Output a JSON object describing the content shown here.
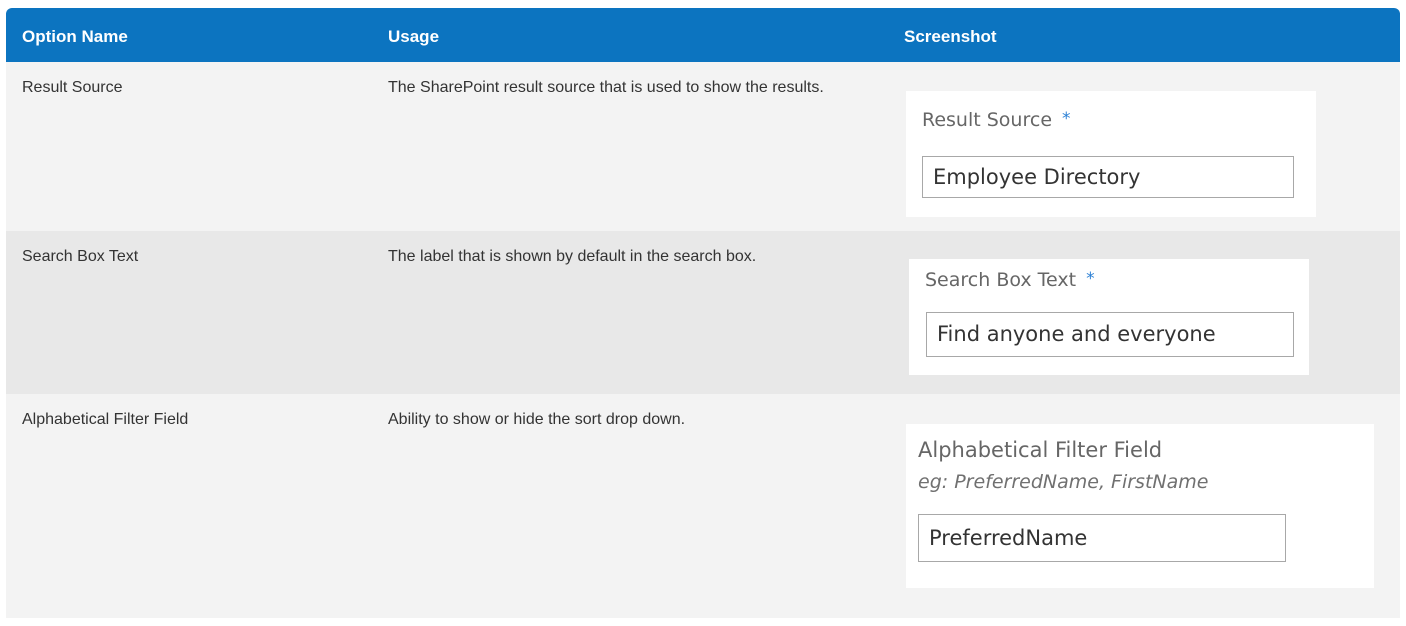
{
  "header": {
    "option_name": "Option Name",
    "usage": "Usage",
    "screenshot": "Screenshot"
  },
  "rows": [
    {
      "option_name": "Result Source",
      "usage": "The SharePoint result source that is used to show the results.",
      "screenshot": {
        "label": "Result Source",
        "required_mark": "*",
        "value": "Employee Directory"
      }
    },
    {
      "option_name": "Search Box Text",
      "usage": "The label that is shown by default in the search box.",
      "screenshot": {
        "label": "Search Box Text",
        "required_mark": "*",
        "value": "Find anyone and everyone"
      }
    },
    {
      "option_name": "Alphabetical Filter Field",
      "usage": "Ability to show or hide the sort drop down.",
      "screenshot": {
        "label": "Alphabetical Filter Field",
        "hint": "eg: PreferredName, FirstName",
        "value": "PreferredName"
      }
    }
  ],
  "colors": {
    "header_bg": "#0c74c0",
    "row_bg_light": "#f3f3f3",
    "row_bg_dark": "#e8e8e8",
    "required_mark": "#2a7fd4"
  }
}
